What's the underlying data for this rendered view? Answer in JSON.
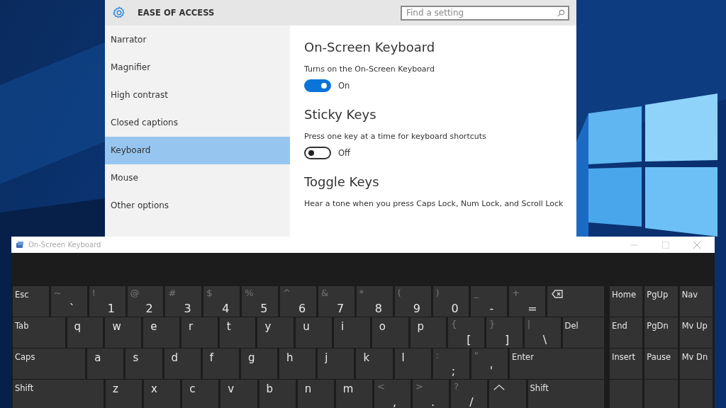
{
  "settings": {
    "title": "EASE OF ACCESS",
    "search": {
      "placeholder": "Find a setting"
    },
    "sidebar": {
      "items": [
        {
          "label": "Narrator",
          "selected": false
        },
        {
          "label": "Magnifier",
          "selected": false
        },
        {
          "label": "High contrast",
          "selected": false
        },
        {
          "label": "Closed captions",
          "selected": false
        },
        {
          "label": "Keyboard",
          "selected": true
        },
        {
          "label": "Mouse",
          "selected": false
        },
        {
          "label": "Other options",
          "selected": false
        }
      ]
    },
    "sections": [
      {
        "heading": "On-Screen Keyboard",
        "description": "Turns on the On-Screen Keyboard",
        "toggle": {
          "on": true,
          "label": "On"
        }
      },
      {
        "heading": "Sticky Keys",
        "description": "Press one key at a time for keyboard shortcuts",
        "toggle": {
          "on": false,
          "label": "Off"
        }
      },
      {
        "heading": "Toggle Keys",
        "description": "Hear a tone when you press Caps Lock, Num Lock, and Scroll Lock"
      }
    ]
  },
  "keyboard_window": {
    "title": "On-Screen Keyboard",
    "main_keys": [
      [
        {
          "kind": "func",
          "label": "Esc"
        },
        {
          "kind": "char",
          "shift": "~",
          "label": "`"
        },
        {
          "kind": "char",
          "shift": "!",
          "label": "1"
        },
        {
          "kind": "char",
          "shift": "@",
          "label": "2"
        },
        {
          "kind": "char",
          "shift": "#",
          "label": "3"
        },
        {
          "kind": "char",
          "shift": "$",
          "label": "4"
        },
        {
          "kind": "char",
          "shift": "%",
          "label": "5"
        },
        {
          "kind": "char",
          "shift": "^",
          "label": "6"
        },
        {
          "kind": "char",
          "shift": "&",
          "label": "7"
        },
        {
          "kind": "char",
          "shift": "*",
          "label": "8"
        },
        {
          "kind": "char",
          "shift": "(",
          "label": "9"
        },
        {
          "kind": "char",
          "shift": ")",
          "label": "0"
        },
        {
          "kind": "char",
          "shift": "_",
          "label": "-"
        },
        {
          "kind": "char",
          "shift": "+",
          "label": "="
        },
        {
          "kind": "backspace"
        }
      ],
      [
        {
          "kind": "func",
          "label": "Tab"
        },
        {
          "kind": "letter",
          "label": "q"
        },
        {
          "kind": "letter",
          "label": "w"
        },
        {
          "kind": "letter",
          "label": "e"
        },
        {
          "kind": "letter",
          "label": "r"
        },
        {
          "kind": "letter",
          "label": "t"
        },
        {
          "kind": "letter",
          "label": "y"
        },
        {
          "kind": "letter",
          "label": "u"
        },
        {
          "kind": "letter",
          "label": "i"
        },
        {
          "kind": "letter",
          "label": "o"
        },
        {
          "kind": "letter",
          "label": "p"
        },
        {
          "kind": "char",
          "shift": "{",
          "label": "["
        },
        {
          "kind": "char",
          "shift": "}",
          "label": "]"
        },
        {
          "kind": "char",
          "shift": "|",
          "label": "\\"
        },
        {
          "kind": "func",
          "label": "Del"
        }
      ],
      [
        {
          "kind": "func",
          "label": "Caps"
        },
        {
          "kind": "letter",
          "label": "a"
        },
        {
          "kind": "letter",
          "label": "s"
        },
        {
          "kind": "letter",
          "label": "d"
        },
        {
          "kind": "letter",
          "label": "f"
        },
        {
          "kind": "letter",
          "label": "g"
        },
        {
          "kind": "letter",
          "label": "h"
        },
        {
          "kind": "letter",
          "label": "j"
        },
        {
          "kind": "letter",
          "label": "k"
        },
        {
          "kind": "letter",
          "label": "l"
        },
        {
          "kind": "char",
          "shift": ":",
          "label": ";"
        },
        {
          "kind": "char",
          "shift": "\"",
          "label": "'"
        },
        {
          "kind": "func",
          "label": "Enter"
        }
      ],
      [
        {
          "kind": "func",
          "label": "Shift"
        },
        {
          "kind": "letter",
          "label": "z"
        },
        {
          "kind": "letter",
          "label": "x"
        },
        {
          "kind": "letter",
          "label": "c"
        },
        {
          "kind": "letter",
          "label": "v"
        },
        {
          "kind": "letter",
          "label": "b"
        },
        {
          "kind": "letter",
          "label": "n"
        },
        {
          "kind": "letter",
          "label": "m"
        },
        {
          "kind": "char",
          "shift": "<",
          "label": ","
        },
        {
          "kind": "char",
          "shift": ">",
          "label": "."
        },
        {
          "kind": "char",
          "shift": "?",
          "label": "/"
        },
        {
          "kind": "up"
        },
        {
          "kind": "func",
          "label": "Shift"
        }
      ]
    ],
    "nav_keys": [
      [
        {
          "kind": "func",
          "label": "Home"
        },
        {
          "kind": "func",
          "label": "PgUp"
        },
        {
          "kind": "func",
          "label": "Nav"
        }
      ],
      [
        {
          "kind": "func",
          "label": "End"
        },
        {
          "kind": "func",
          "label": "PgDn"
        },
        {
          "kind": "func",
          "label": "Mv Up"
        }
      ],
      [
        {
          "kind": "func",
          "label": "Insert"
        },
        {
          "kind": "func",
          "label": "Pause"
        },
        {
          "kind": "func",
          "label": "Mv Dn"
        }
      ],
      [
        {
          "kind": "blank"
        },
        {
          "kind": "blank"
        },
        {
          "kind": "blank"
        }
      ]
    ]
  }
}
